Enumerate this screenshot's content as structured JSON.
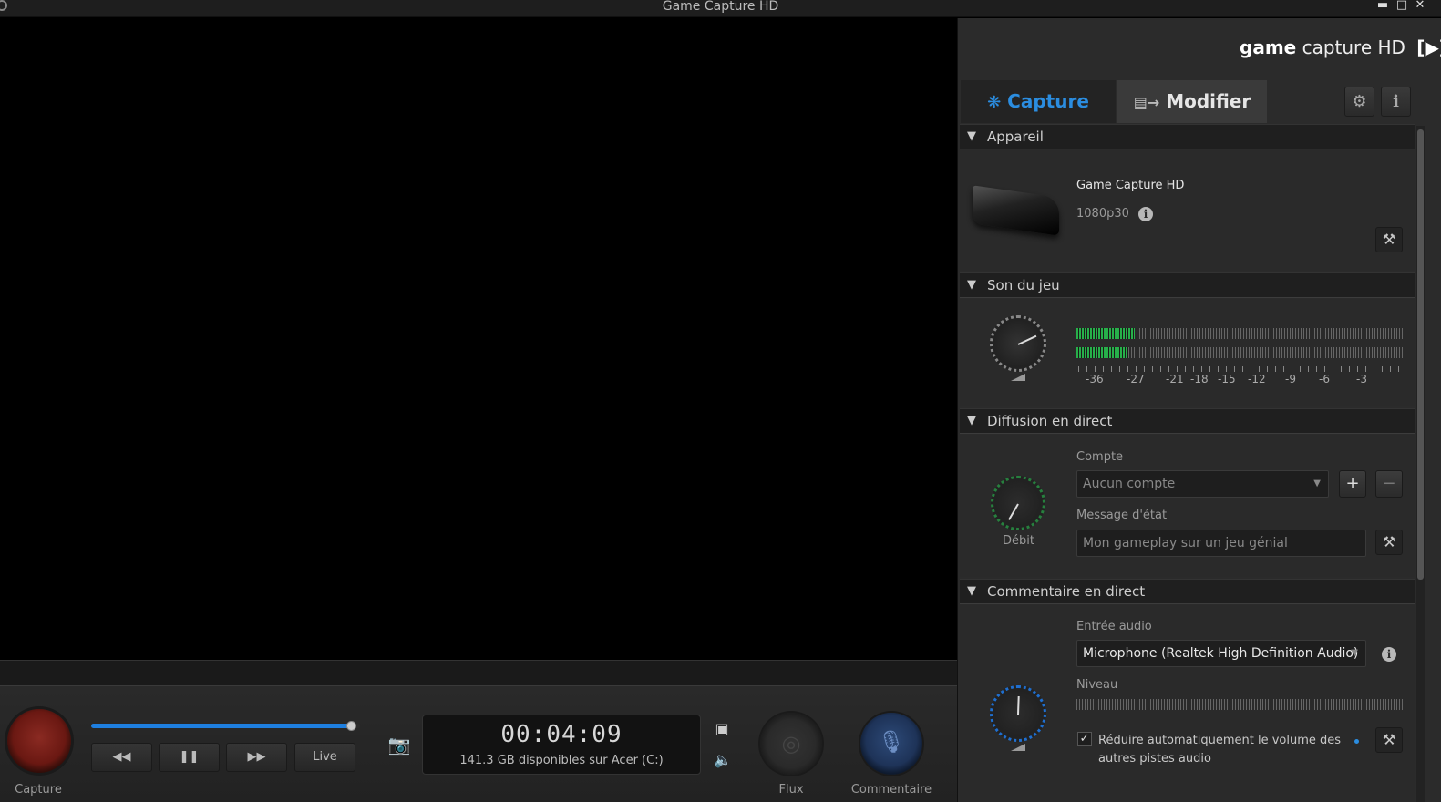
{
  "window": {
    "title": "Game Capture HD"
  },
  "brand": {
    "bold": "game",
    "rest": "capture HD"
  },
  "tabs": [
    {
      "label": "Capture",
      "active": true,
      "icon": "paw-icon"
    },
    {
      "label": "Modifier",
      "active": false,
      "icon": "camera-edit-icon"
    }
  ],
  "sections": {
    "appareil": {
      "title": "Appareil",
      "device_name": "Game Capture HD",
      "resolution": "1080p30"
    },
    "son": {
      "title": "Son du jeu",
      "meter_levels": [
        0.18,
        0.16
      ],
      "scale": [
        "-36",
        "-27",
        "-21",
        "-18",
        "-15",
        "-12",
        "-9",
        "-6",
        "-3"
      ]
    },
    "diffusion": {
      "title": "Diffusion en direct",
      "knob_label": "Débit",
      "account_label": "Compte",
      "account_value": "Aucun compte",
      "status_label": "Message d'état",
      "status_placeholder": "Mon gameplay sur un jeu génial"
    },
    "commentaire": {
      "title": "Commentaire en direct",
      "audio_input_label": "Entrée audio",
      "audio_input_value": "Microphone (Realtek High Definition Audio)",
      "level_label": "Niveau",
      "auto_reduce_label": "Réduire automatiquement le volume des autres pistes audio",
      "auto_reduce_checked": true
    }
  },
  "controls": {
    "capture_label": "Capture",
    "live_label": "Live",
    "time": "00:04:09",
    "disk_info": "141.3 GB disponibles sur Acer (C:)",
    "flux_label": "Flux",
    "commentaire_label": "Commentaire",
    "progress": 0.97
  },
  "colors": {
    "accent": "#2b8de0",
    "meter_green": "#27b04a",
    "capture_red": "#7a1a14"
  }
}
